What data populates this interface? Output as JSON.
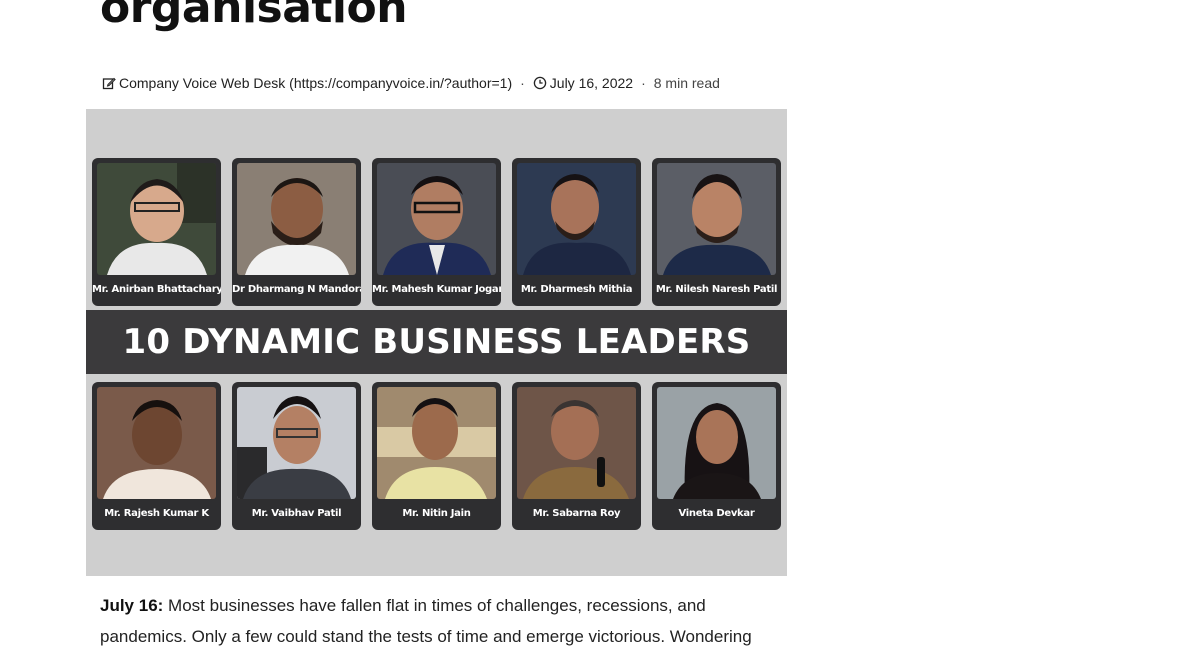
{
  "article": {
    "title": "organisation",
    "meta": {
      "author": "Company Voice Web Desk (https://companyvoice.in/?author=1)",
      "date": "July 16, 2022",
      "read_time": "8 min read",
      "separator": "·"
    },
    "hero": {
      "banner": "10 DYNAMIC BUSINESS LEADERS",
      "top_row": [
        "Mr. Anirban Bhattacharya",
        "Dr Dharmang N Mandora",
        "Mr. Mahesh Kumar Jogani",
        "Mr. Dharmesh Mithia",
        "Mr. Nilesh Naresh Patil"
      ],
      "bottom_row": [
        "Mr. Rajesh Kumar K",
        "Mr. Vaibhav Patil",
        "Mr. Nitin Jain",
        "Mr. Sabarna Roy",
        "Vineta Devkar"
      ]
    },
    "body": {
      "lead": "July 16:",
      "text": "Most businesses have fallen flat in times of challenges, recessions, and pandemics. Only a few could stand the tests of time and emerge victorious. Wondering"
    }
  },
  "icons": {
    "author": "edit-icon",
    "date": "clock-icon"
  }
}
